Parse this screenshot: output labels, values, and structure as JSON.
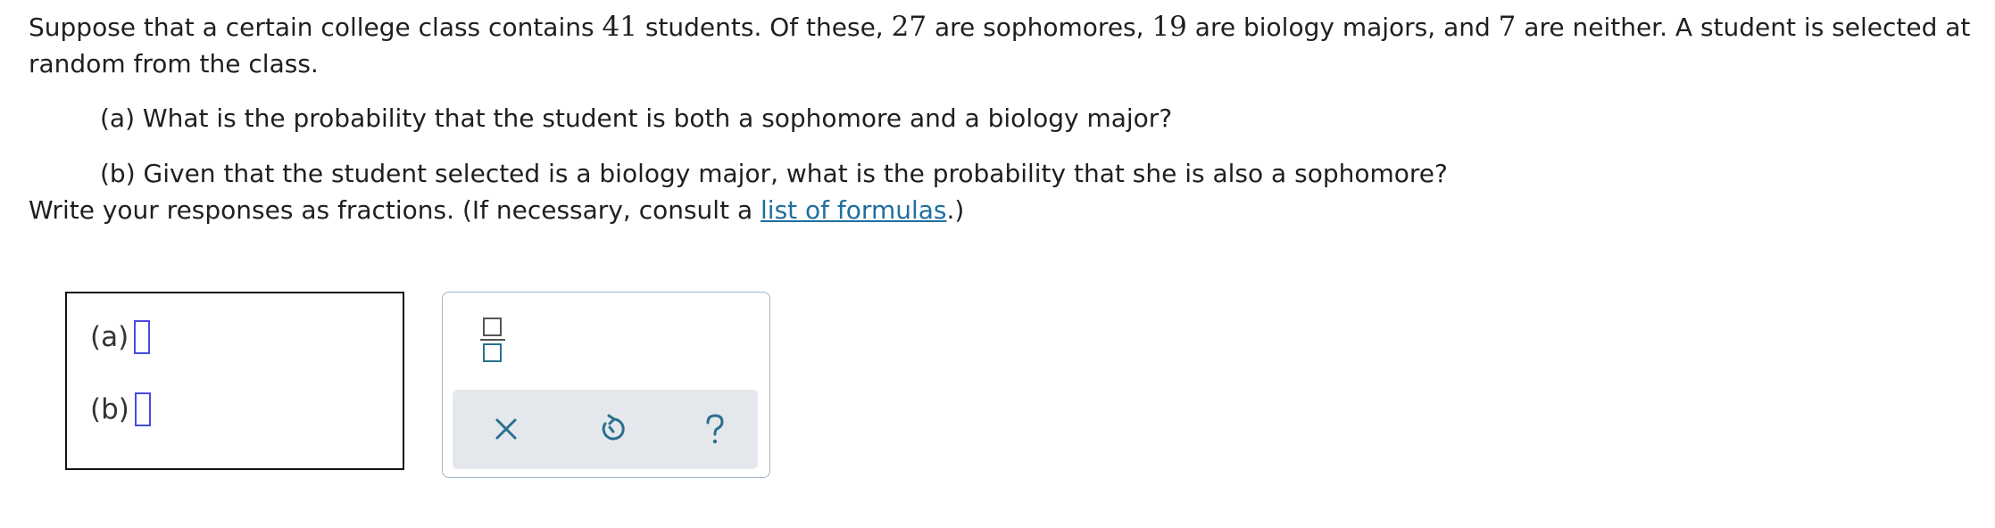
{
  "problem": {
    "intro_1": "Suppose that a certain college class contains ",
    "total_students": "41",
    "intro_2": " students. Of these, ",
    "sophomores": "27",
    "intro_3": " are sophomores, ",
    "biology_majors": "19",
    "intro_4": " are biology majors, and ",
    "neither": "7",
    "intro_5": " are neither. A student is selected at random from the class.",
    "question_a": "(a) What is the probability that the student is both a sophomore and a biology major?",
    "question_b": "(b) Given that the student selected is a biology major, what is the probability that she is also a sophomore?",
    "instruction_before": "Write your responses as fractions. (If necessary, consult a ",
    "formulas_link": "list of formulas",
    "instruction_after": ".)"
  },
  "answers": {
    "a_label": "(a)",
    "a_value": "",
    "b_label": "(b)",
    "b_value": ""
  },
  "tools": {
    "fraction_icon": "fraction-icon",
    "clear_icon": "x-icon",
    "undo_icon": "undo-icon",
    "help_icon": "question-icon"
  },
  "colors": {
    "link": "#1e6fa0",
    "input_border": "#4a4ae0",
    "icon": "#2a6f8f",
    "action_bar_bg": "#e4e8ec",
    "panel_border": "#9fb3c8"
  }
}
